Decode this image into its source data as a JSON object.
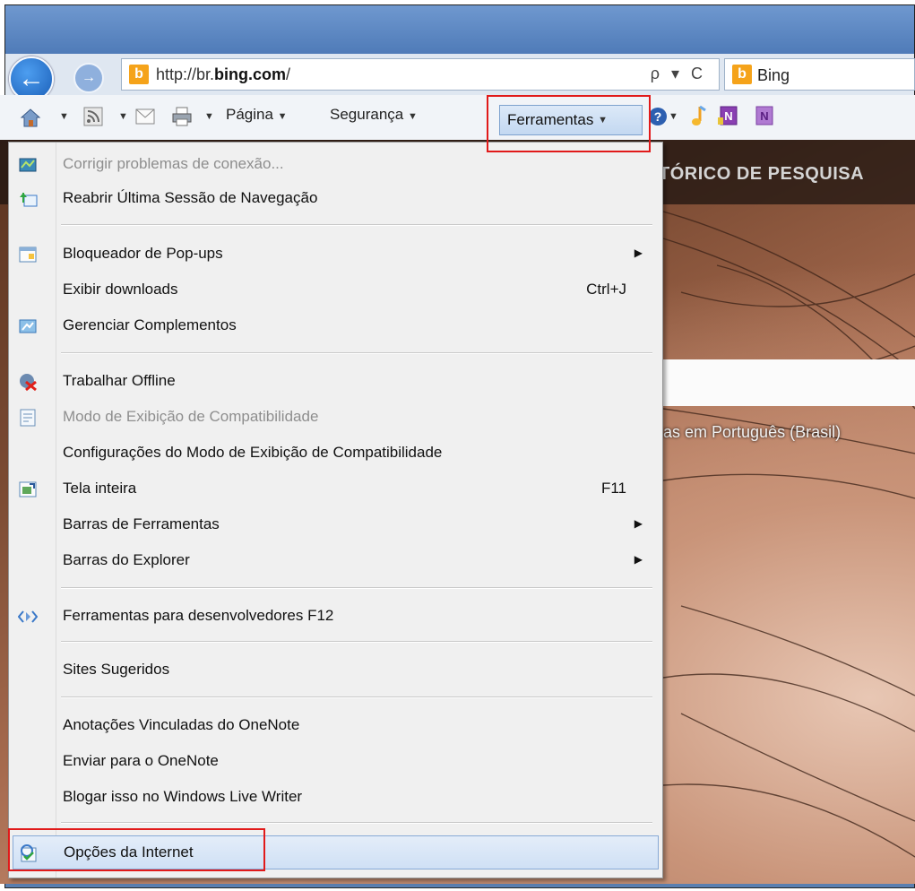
{
  "browser": {
    "address": {
      "url_prefix": "http://br.",
      "url_domain": "bing.com",
      "url_suffix": "/",
      "tools": "ρ ▾ C"
    },
    "tab": {
      "title": "Bing"
    },
    "favicon_letter": "b",
    "nav": {
      "back_icon": "back-arrow-icon",
      "forward_icon": "forward-arrow-icon"
    }
  },
  "command_bar": {
    "pagina": "Página",
    "seguranca": "Segurança",
    "ferramentas": "Ferramentas"
  },
  "page": {
    "heading": "TÓRICO DE PESQUISA",
    "language": "ıas em Português (Brasil)"
  },
  "menu": {
    "items": [
      {
        "label": "Corrigir problemas de conexão...",
        "disabled": true,
        "icon": "connection-diagnostics-icon"
      },
      {
        "label": "Reabrir Última Sessão de Navegação",
        "icon": "reopen-session-icon"
      },
      {
        "label": "Bloqueador de Pop-ups",
        "submenu": true,
        "icon": "popup-blocker-icon"
      },
      {
        "label": "Exibir downloads",
        "shortcut": "Ctrl+J"
      },
      {
        "label": "Gerenciar Complementos",
        "icon": "addons-icon"
      },
      {
        "label": "Trabalhar Offline",
        "icon": "work-offline-icon"
      },
      {
        "label": "Modo de Exibição de Compatibilidade",
        "disabled": true,
        "icon": "compatibility-view-icon"
      },
      {
        "label": "Configurações do Modo de Exibição de Compatibilidade"
      },
      {
        "label": "Tela inteira",
        "shortcut": "F11",
        "icon": "fullscreen-icon"
      },
      {
        "label": "Barras de Ferramentas",
        "submenu": true
      },
      {
        "label": "Barras do Explorer",
        "submenu": true
      },
      {
        "label": "Ferramentas para desenvolvedores F12",
        "icon": "developer-tools-icon"
      },
      {
        "label": "Sites Sugeridos"
      },
      {
        "label": "Anotações Vinculadas do OneNote"
      },
      {
        "label": "Enviar para o OneNote"
      },
      {
        "label": "Blogar isso no Windows Live Writer"
      },
      {
        "label": "Opções da Internet",
        "highlighted": true,
        "icon": "internet-options-icon"
      }
    ],
    "arrow": "▶"
  },
  "colors": {
    "highlight_border": "#e11a1a",
    "menu_bg": "#f0f0f0",
    "disabled_text": "#8e8e8e"
  }
}
